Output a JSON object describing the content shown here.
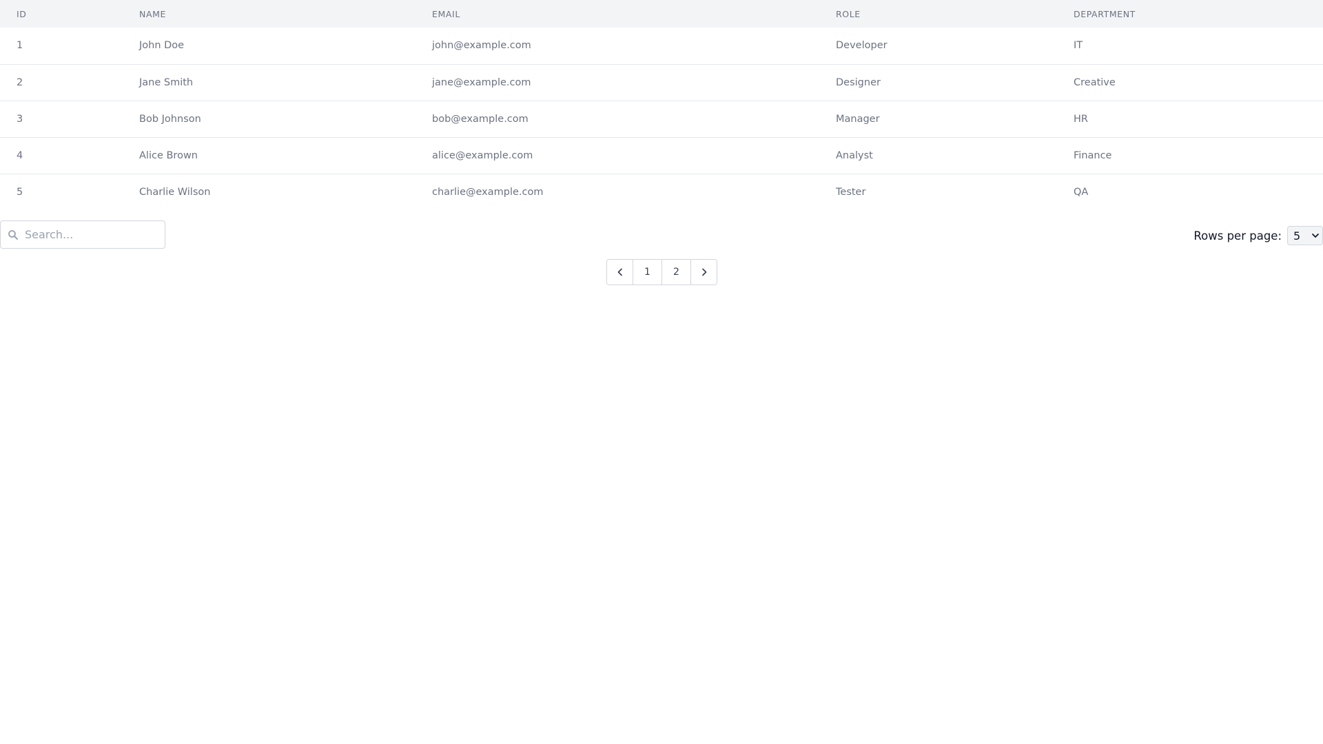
{
  "table": {
    "columns": [
      "ID",
      "NAME",
      "EMAIL",
      "ROLE",
      "DEPARTMENT"
    ],
    "rows": [
      [
        "1",
        "John Doe",
        "john@example.com",
        "Developer",
        "IT"
      ],
      [
        "2",
        "Jane Smith",
        "jane@example.com",
        "Designer",
        "Creative"
      ],
      [
        "3",
        "Bob Johnson",
        "bob@example.com",
        "Manager",
        "HR"
      ],
      [
        "4",
        "Alice Brown",
        "alice@example.com",
        "Analyst",
        "Finance"
      ],
      [
        "5",
        "Charlie Wilson",
        "charlie@example.com",
        "Tester",
        "QA"
      ]
    ]
  },
  "search": {
    "placeholder": "Search...",
    "value": ""
  },
  "rows_per_page": {
    "label": "Rows per page:",
    "selected": "5"
  },
  "pagination": {
    "pages": [
      "1",
      "2"
    ]
  },
  "icons": {
    "search": "search-icon",
    "prev": "chevron-left-icon",
    "next": "chevron-right-icon",
    "select": "chevron-down-icon"
  },
  "colors": {
    "header_bg": "#f3f4f6",
    "border": "#d1d5db",
    "text_muted": "#6b7280"
  }
}
